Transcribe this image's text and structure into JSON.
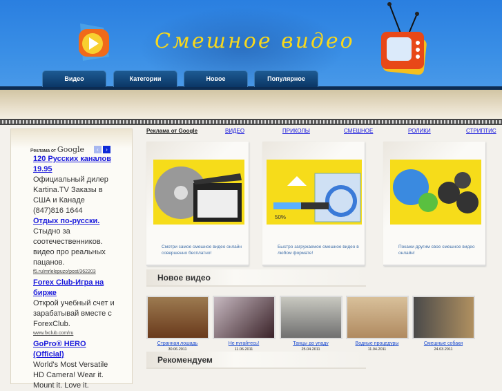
{
  "header": {
    "site_title": "Смешное видео",
    "nav": [
      "Видео",
      "Категории",
      "Новое",
      "Популярное"
    ]
  },
  "sidebar": {
    "ad_label": "Реклама от",
    "ad_brand": "Google",
    "prev": "‹",
    "next": "›",
    "ads": [
      {
        "title": "120 Русских каналов 19.95",
        "text": "Официальный дилер Kartina.TV Заказы в США и Канаде (847)816 1644",
        "url": ""
      },
      {
        "title": "Отдых по-русски.",
        "text": "Стыдно за соотечественников. видео про реальных пацанов.",
        "url": "f5.ru/mrlelepuzo/post/362203"
      },
      {
        "title": "Forex Club-Игра на бирже",
        "text": "Открой учебный счет и зарабатывай вместе с ForexClub.",
        "url": "www.fxclub.com/ru"
      },
      {
        "title": "GoPro® HERO (Official)",
        "text": "World's Most Versatile HD Camera! Wear it. Mount it. Love it.",
        "url": ""
      }
    ]
  },
  "toplinks": {
    "ad_label": "Реклама от Google",
    "links": [
      "ВИДЕО",
      "ПРИКОЛЫ",
      "СМЕШНОЕ",
      "РОЛИКИ",
      "СТРИПТИС"
    ]
  },
  "features": [
    {
      "text": "Смотри самое смешное видео онлайн совершенно бесплатно!"
    },
    {
      "text": "Быстро загружаемое смешное видео в любом формате!",
      "progress_label": "50%"
    },
    {
      "text": "Покажи другим свое смешное видео онлайн!"
    }
  ],
  "sections": {
    "new": "Новое видео",
    "recommended": "Рекомендуем"
  },
  "videos": [
    {
      "title": "Странная лошадь",
      "date": "30.06.2011"
    },
    {
      "title": "Не пугайтесь!",
      "date": "11.06.2011"
    },
    {
      "title": "Танцы до упаду",
      "date": "25.04.2011"
    },
    {
      "title": "Водные процедуры",
      "date": "11.04.2011"
    },
    {
      "title": "Смешные собаки",
      "date": "24.03.2011"
    }
  ]
}
